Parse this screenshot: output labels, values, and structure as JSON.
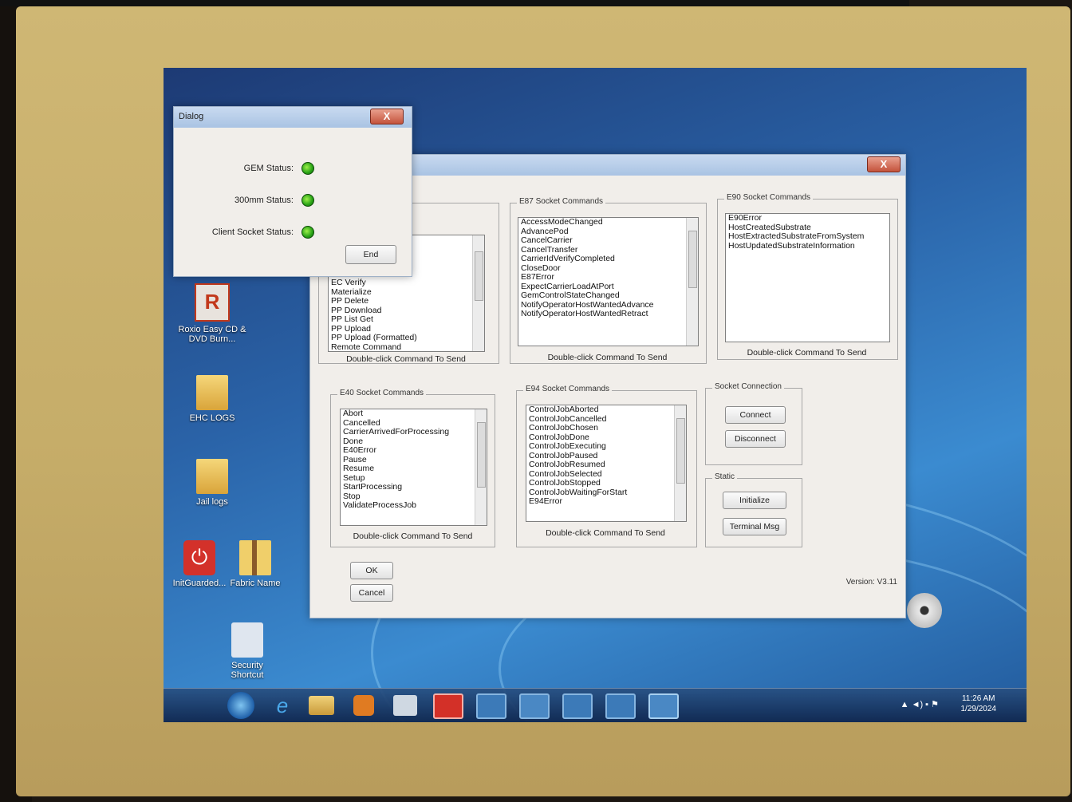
{
  "status_dialog": {
    "title": "Dialog",
    "close_glyph": "X",
    "gem_label": "GEM Status:",
    "mm300_label": "300mm Status:",
    "socket_label": "Client Socket Status:",
    "end_label": "End",
    "led_color": "#2bb31a"
  },
  "main_dialog": {
    "close_glyph": "X",
    "version": "Version: V3.11",
    "ok_label": "OK",
    "cancel_label": "Cancel",
    "top_left_group": {
      "items": [
        "EC Verify",
        "Materialize",
        "PP Delete",
        "PP Download",
        "PP List Get",
        "PP Upload",
        "PP Upload (Formatted)",
        "Remote Command"
      ],
      "caption": "Double-click Command To Send"
    },
    "e87_group": {
      "title": "E87 Socket Commands",
      "items": [
        "AccessModeChanged",
        "AdvancePod",
        "CancelCarrier",
        "CancelTransfer",
        "CarrierIdVerifyCompleted",
        "CloseDoor",
        "E87Error",
        "ExpectCarrierLoadAtPort",
        "GemControlStateChanged",
        "NotifyOperatorHostWantedAdvance",
        "NotifyOperatorHostWantedRetract"
      ],
      "caption": "Double-click Command To Send"
    },
    "e90_group": {
      "title": "E90 Socket Commands",
      "items": [
        "E90Error",
        "HostCreatedSubstrate",
        "HostExtractedSubstrateFromSystem",
        "HostUpdatedSubstrateInformation"
      ],
      "caption": "Double-click Command To Send"
    },
    "e40_group": {
      "title": "E40 Socket Commands",
      "items": [
        "Abort",
        "Cancelled",
        "CarrierArrivedForProcessing",
        "Done",
        "E40Error",
        "Pause",
        "Resume",
        "Setup",
        "StartProcessing",
        "Stop",
        "ValidateProcessJob"
      ],
      "caption": "Double-click Command To Send"
    },
    "e94_group": {
      "title": "E94 Socket Commands",
      "items": [
        "ControlJobAborted",
        "ControlJobCancelled",
        "ControlJobChosen",
        "ControlJobDone",
        "ControlJobExecuting",
        "ControlJobPaused",
        "ControlJobResumed",
        "ControlJobSelected",
        "ControlJobStopped",
        "ControlJobWaitingForStart",
        "E94Error"
      ],
      "caption": "Double-click Command To Send"
    },
    "socket_connection": {
      "title": "Socket Connection",
      "connect_label": "Connect",
      "disconnect_label": "Disconnect"
    },
    "static_group": {
      "title": "Static",
      "initialize_label": "Initialize",
      "terminal_label": "Terminal Msg"
    }
  },
  "desktop": {
    "icons": [
      {
        "label": "Roxio Easy CD & DVD Burn..."
      },
      {
        "label": "EHC LOGS"
      },
      {
        "label": "Jail logs"
      },
      {
        "label": "InitGuarded..."
      },
      {
        "label": "Fabric Name"
      },
      {
        "label": "Security Shortcut"
      }
    ]
  },
  "taskbar": {
    "time": "11:26 AM",
    "date": "1/29/2024",
    "tray_glyphs": "▲ ◄) ▪ ⚑",
    "buttons": [
      "start-orb",
      "internet-explorer",
      "file-explorer",
      "media-player",
      "network",
      "power",
      "folder",
      "globe",
      "terminal",
      "window-1",
      "window-2"
    ]
  }
}
